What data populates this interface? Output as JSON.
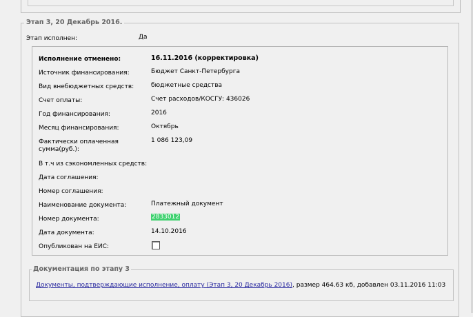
{
  "stage": {
    "legend": "Этап 3, 20 Декабрь 2016.",
    "done_label": "Этап исполнен:",
    "done_value": "Да"
  },
  "details": {
    "rows": [
      {
        "label": "Исполнение отменено:",
        "value": "16.11.2016 (корректировка)"
      },
      {
        "label": "Источник финансирования:",
        "value": "Бюджет Санкт-Петербурга"
      },
      {
        "label": "Вид внебюджетных средств:",
        "value": "бюджетные средства"
      },
      {
        "label": "Счет оплаты:",
        "value": "Счет расходов/КОСГУ: 436026"
      },
      {
        "label": "Год финансирования:",
        "value": "2016"
      },
      {
        "label": "Месяц финансирования:",
        "value": "Октябрь"
      },
      {
        "label": "Фактически оплаченная",
        "value": "1 086 123,09"
      },
      {
        "label": "сумма(руб.):",
        "value": ""
      },
      {
        "label": "В т.ч из сэкономленных средств:",
        "value": ""
      },
      {
        "label": "Дата соглашения:",
        "value": ""
      },
      {
        "label": "Номер соглашения:",
        "value": ""
      },
      {
        "label": "Наименование документа:",
        "value": "Платежный документ"
      },
      {
        "label": "Номер документа:",
        "value": "2833012"
      },
      {
        "label": "Дата документа:",
        "value": "14.10.2016"
      },
      {
        "label": "Опубликован на ЕИС:",
        "value": ""
      }
    ]
  },
  "documentation": {
    "legend": "Документация по этапу 3",
    "link_text": "Документы, подтверждающие исполнение, оплату (Этап 3, 20 Декабрь 2016)",
    "suffix": ", размер 464.63 кб, добавлен 03.11.2016 11:03"
  }
}
